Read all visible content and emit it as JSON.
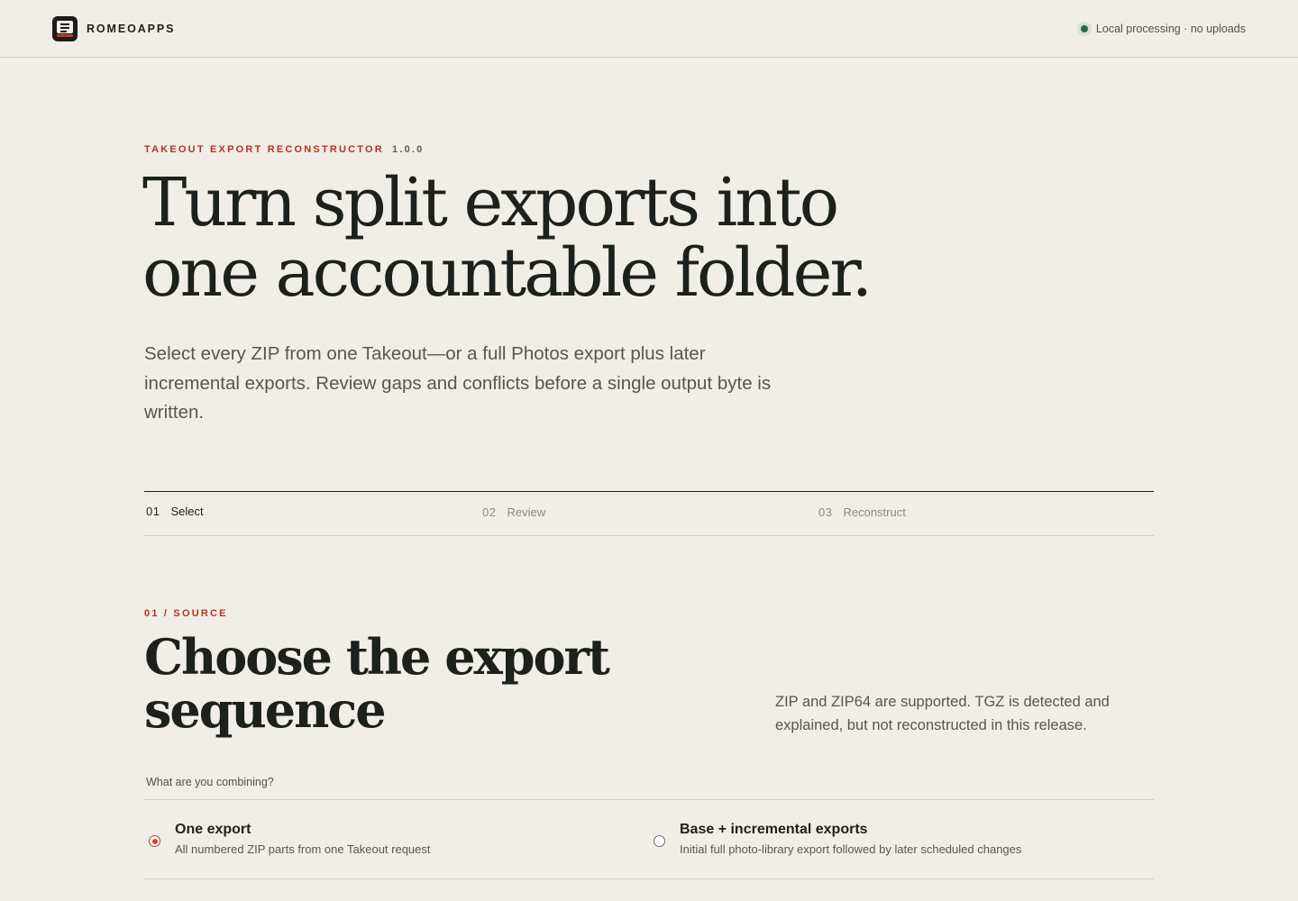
{
  "header": {
    "brand": "ROMEOAPPS",
    "status_text": "Local processing · no uploads",
    "status_color": "#1f6f4a",
    "logo_icon": "app-logo-icon"
  },
  "hero": {
    "eyebrow": "TAKEOUT EXPORT RECONSTRUCTOR",
    "version": "1.0.0",
    "title_line1": "Turn split exports into",
    "title_line2": "one accountable folder.",
    "subtitle": "Select every ZIP from one Takeout—or a full Photos export plus later incremental exports. Review gaps and conflicts before a single output byte is written."
  },
  "steps": [
    {
      "num": "01",
      "label": "Select",
      "active": true
    },
    {
      "num": "02",
      "label": "Review",
      "active": false
    },
    {
      "num": "03",
      "label": "Reconstruct",
      "active": false
    }
  ],
  "source": {
    "eyebrow": "01 / SOURCE",
    "title_line1": "Choose the export",
    "title_line2": "sequence",
    "note": "ZIP and ZIP64 are supported. TGZ is detected and explained, but not reconstructed in this release.",
    "question": "What are you combining?",
    "options": [
      {
        "title": "One export",
        "desc": "All numbered ZIP parts from one Takeout request",
        "selected": true
      },
      {
        "title": "Base + incremental exports",
        "desc": "Initial full photo-library export followed by later scheduled changes",
        "selected": false
      }
    ]
  },
  "colors": {
    "background": "#f1eee7",
    "accent": "#b0341f",
    "text": "#1d211d",
    "muted": "#555852"
  }
}
